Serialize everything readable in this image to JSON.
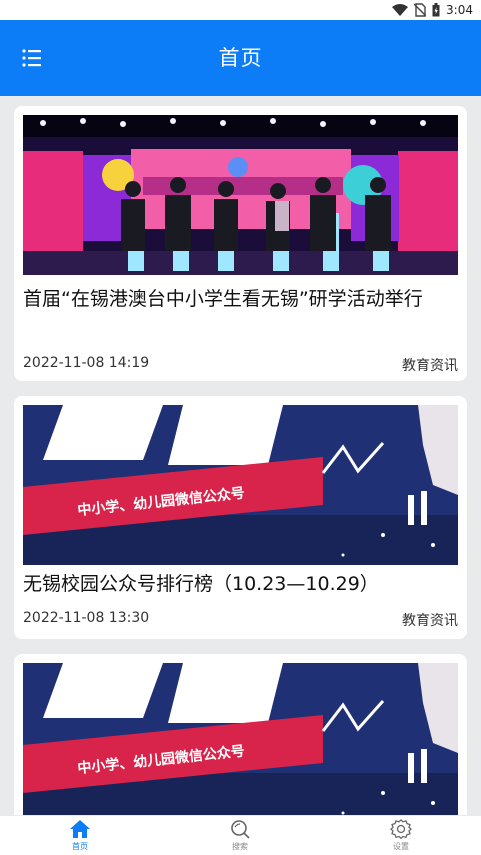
{
  "statusbar": {
    "time": "3:04",
    "icons": [
      "wifi-icon",
      "no-sim-icon",
      "battery-icon"
    ]
  },
  "appbar": {
    "title": "首页",
    "menu_icon": "list-menu-icon"
  },
  "articles": [
    {
      "title": "首届“在锡港澳台中小学生看无锡”研学活动举行",
      "date": "2022-11-08 14:19",
      "category": "教育资讯",
      "image": "ceremony-photo"
    },
    {
      "title": "无锡校园公众号排行榜（10.23—10.29）",
      "date": "2022-11-08 13:30",
      "category": "教育资讯",
      "image": "ranking-banner",
      "banner_text": "中小学、幼儿园微信公众号"
    },
    {
      "image": "ranking-banner",
      "banner_text": "中小学、幼儿园微信公众号"
    }
  ],
  "tabs": [
    {
      "label": "首页",
      "icon": "home-icon",
      "active": true
    },
    {
      "label": "搜索",
      "icon": "search-icon",
      "active": false
    },
    {
      "label": "设置",
      "icon": "settings-gear-icon",
      "active": false
    }
  ],
  "colors": {
    "primary": "#0c7cf7",
    "background": "#e9eaec",
    "tab_inactive": "#888888"
  }
}
